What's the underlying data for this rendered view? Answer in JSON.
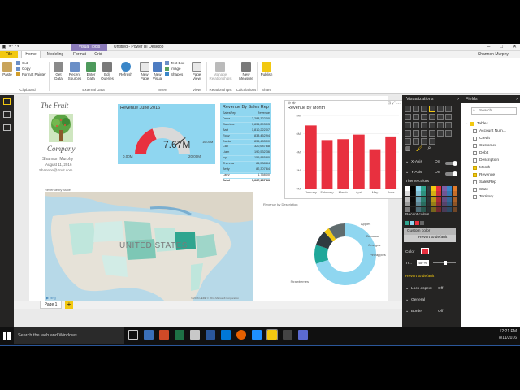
{
  "window": {
    "context_tab": "Visual Tools",
    "title": "Untitled - Power BI Desktop",
    "user": "Shannon Murphy",
    "controls": [
      "–",
      "□",
      "✕"
    ]
  },
  "ribbon_tabs": [
    "File",
    "Home",
    "Modeling",
    "Format",
    "Grid"
  ],
  "ribbon": {
    "paste": "Paste",
    "cut": "Cut",
    "copy": "Copy",
    "format_painter": "Format Painter",
    "get_data": "Get\nData",
    "recent_sources": "Recent\nSources",
    "enter_data": "Enter\nData",
    "edit_queries": "Edit\nQueries",
    "refresh": "Refresh",
    "new_page": "New\nPage",
    "new_visual": "New\nVisual",
    "text_box": "Text Box",
    "image": "Image",
    "shapes": "Shapes",
    "page_view": "Page\nView",
    "manage_relationships": "Manage\nRelationships",
    "new_measure": "New\nMeasure",
    "publish": "Publish",
    "groups": [
      "Clipboard",
      "External Data",
      "Insert",
      "View",
      "Relationships",
      "Calculations",
      "Share"
    ]
  },
  "report": {
    "logo_line1": "The Fruit",
    "logo_line2": "Company",
    "author": "Shannon Murphy",
    "date": "August 11, 2016",
    "email": "Shannon@Fruit.com",
    "gauge": {
      "title": "Revenue June 2016",
      "value": "7.67M",
      "min": "0.00M",
      "max": "20.00M",
      "target": "16.00M",
      "fill_fraction": 0.38,
      "color": "#e8303f"
    },
    "sales_rep": {
      "title": "Revenue By Sales Rep",
      "headers": [
        "SalesRep",
        "Revenue"
      ],
      "rows": [
        [
          "Dana",
          "2,288,322.00"
        ],
        [
          "Gabriela",
          "1,834,293.03"
        ],
        [
          "Bart",
          "1,810,222.07"
        ],
        [
          "Rosy",
          "838,452.94"
        ],
        [
          "Dayla",
          "836,483.00"
        ],
        [
          "Carl",
          "320,687.68"
        ],
        [
          "Liam",
          "190,532.36"
        ],
        [
          "Ivy",
          "159,885.80"
        ],
        [
          "Theresa",
          "84,538.84"
        ],
        [
          "Betty",
          "82,307.64"
        ],
        [
          "Larry",
          "1,758.00"
        ]
      ],
      "total_label": "Total",
      "total_value": "7,667,187.83"
    },
    "bar_chart_title": "Revenue by Month",
    "map_title": "Revenue by State",
    "map_label": "UNITED STATES",
    "map_copyright": "© 2016 HERE  © 2016 Microsoft Corporation",
    "donut_title": "Revenue by Description"
  },
  "chart_data": [
    {
      "type": "bar",
      "title": "Revenue by Month",
      "categories": [
        "January",
        "February",
        "March",
        "April",
        "May",
        "June"
      ],
      "values": [
        6.9,
        5.3,
        5.4,
        5.9,
        4.3,
        5.7
      ],
      "ylim": [
        0,
        8
      ],
      "yticks": [
        "8M",
        "6M",
        "4M",
        "2M",
        "0M"
      ],
      "color": "#e8303f",
      "grid": true
    },
    {
      "type": "pie",
      "title": "Revenue by Description",
      "labels": [
        "Strawberries",
        "Apples",
        "Bananas",
        "Oranges",
        "Pineapples"
      ],
      "values": [
        70,
        10,
        8,
        3,
        9
      ],
      "colors": [
        "#8fd6f0",
        "#1fa89a",
        "#2f3b40",
        "#f2c811",
        "#5f6b6d"
      ]
    }
  ],
  "visualizations": {
    "title": "Visualizations",
    "props": [
      {
        "label": "X-Axis",
        "state": "On"
      },
      {
        "label": "Y-Axis",
        "state": "On"
      }
    ],
    "theme_colors_label": "Theme colors",
    "recent_colors_label": "Recent colors",
    "custom_color": "Custom color",
    "revert_default": "Revert to default",
    "color_label": "Color",
    "transparency_label": "Tr...",
    "transparency_value": "50 %",
    "revert_link": "Revert to default",
    "lock_aspect": "Lock aspect",
    "lock_state": "Off",
    "general": "General",
    "border": "Border",
    "border_state": "Off"
  },
  "fields": {
    "title": "Fields",
    "search_placeholder": "Search",
    "table": "Table1",
    "items": [
      {
        "name": "Account Num...",
        "checked": false
      },
      {
        "name": "Credit",
        "checked": false
      },
      {
        "name": "Customer",
        "checked": false
      },
      {
        "name": "Debit",
        "checked": false
      },
      {
        "name": "Description",
        "checked": false
      },
      {
        "name": "Month",
        "checked": true
      },
      {
        "name": "Revenue",
        "checked": true
      },
      {
        "name": "SalesRep",
        "checked": false
      },
      {
        "name": "State",
        "checked": false
      },
      {
        "name": "Territory",
        "checked": false
      }
    ]
  },
  "pages": {
    "tab": "Page 1",
    "add": "+"
  },
  "status": {
    "page": "PAGE 1 OF 1",
    "update": "UPDATE AVAILABLE (CLICK TO DOWNLOAD)"
  },
  "taskbar": {
    "search_placeholder": "Search the web and Windows",
    "time": "12:21 PM",
    "date": "8/11/2016"
  },
  "colors": {
    "accent": "#f2c811",
    "bar": "#e8303f",
    "card_bg": "#8fd6f0",
    "pane_bg": "#252423"
  }
}
